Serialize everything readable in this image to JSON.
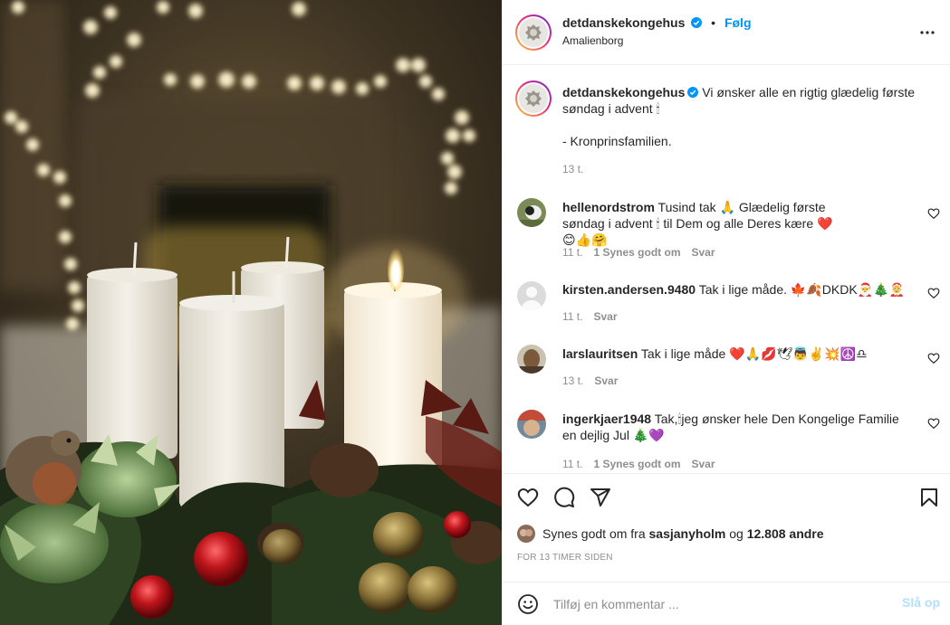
{
  "header": {
    "username": "detdanskekongehus",
    "separator": "•",
    "follow_label": "Følg",
    "location": "Amalienborg"
  },
  "caption": {
    "username": "detdanskekongehus",
    "text": "Vi ønsker alle en rigtig glædelig første søndag i advent 🕯",
    "signature": "- Kronprinsfamilien.",
    "time": "13 t."
  },
  "comments": [
    {
      "username": "hellenordstrom",
      "text": "Tusind tak 🙏 Glædelig første søndag i advent 🕯 til Dem og alle Deres kære ❤️😊👍🤗",
      "time": "11 t.",
      "likes": "1 Synes godt om",
      "reply": "Svar"
    },
    {
      "username": "kirsten.andersen.9480",
      "text": "Tak i lige måde. 🍁🍂DKDK🎅🎄🤶",
      "time": "11 t.",
      "likes": "",
      "reply": "Svar"
    },
    {
      "username": "larslauritsen",
      "text": "Tak i lige måde ❤️🙏💋🕊👼✌️💥☮️♎",
      "time": "13 t.",
      "likes": "",
      "reply": "Svar"
    },
    {
      "username": "ingerkjaer1948",
      "text": "Tak,🕯jeg ønsker hele Den Kongelige Familie en dejlig Jul 🎄💜",
      "time": "11 t.",
      "likes": "1 Synes godt om",
      "reply": "Svar"
    }
  ],
  "likes": {
    "prefix": "Synes godt om fra",
    "user": "sasjanyholm",
    "and": "og",
    "others": "12.808 andre"
  },
  "timestamp": "FOR 13 TIMER SIDEN",
  "add_comment": {
    "placeholder": "Tilføj en kommentar ...",
    "post_label": "Slå op"
  },
  "colors": {
    "accent": "#0095f6",
    "post_disabled": "#b2dffc",
    "muted": "#8e8e8e",
    "text": "#262626",
    "verified": "#0095f6"
  },
  "icons": [
    "more-options-icon",
    "heart-icon",
    "comment-icon",
    "share-icon",
    "bookmark-icon",
    "emoji-icon",
    "verified-badge-icon"
  ]
}
